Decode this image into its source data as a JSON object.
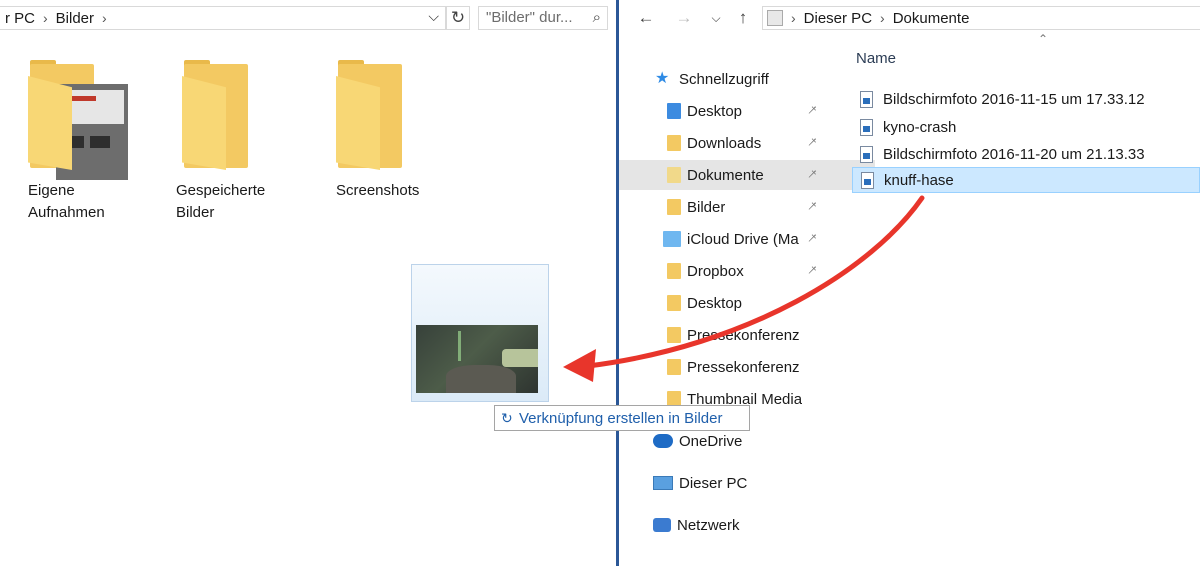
{
  "left": {
    "breadcrumb": [
      "r PC",
      "Bilder"
    ],
    "search_placeholder": "\"Bilder\" dur...",
    "items": [
      {
        "label": "Eigene\nAufnahmen"
      },
      {
        "label": "Gespeicherte\nBilder"
      },
      {
        "label": "Screenshots"
      }
    ]
  },
  "drag": {
    "tooltip": "Verknüpfung erstellen in Bilder"
  },
  "right": {
    "breadcrumb": [
      "Dieser PC",
      "Dokumente"
    ],
    "column_header": "Name",
    "nav": [
      {
        "label": "Schnellzugriff",
        "icon": "star-icon"
      },
      {
        "label": "Desktop",
        "icon": "folder-icon",
        "pinned": true
      },
      {
        "label": "Downloads",
        "icon": "download-folder-icon",
        "pinned": true
      },
      {
        "label": "Dokumente",
        "icon": "documents-folder-icon",
        "pinned": true,
        "selected": true
      },
      {
        "label": "Bilder",
        "icon": "pictures-folder-icon",
        "pinned": true
      },
      {
        "label": "iCloud Drive (Ma",
        "icon": "icloud-folder-icon",
        "pinned": true
      },
      {
        "label": "Dropbox",
        "icon": "dropbox-folder-icon",
        "pinned": true
      },
      {
        "label": "Desktop",
        "icon": "folder-icon"
      },
      {
        "label": "Pressekonferenz",
        "icon": "folder-icon"
      },
      {
        "label": "Pressekonferenz",
        "icon": "folder-icon"
      },
      {
        "label": "Thumbnail Media",
        "icon": "folder-icon"
      },
      {
        "label": "OneDrive",
        "icon": "onedrive-icon"
      },
      {
        "label": "Dieser PC",
        "icon": "computer-icon"
      },
      {
        "label": "Netzwerk",
        "icon": "network-icon"
      }
    ],
    "files": [
      {
        "name": "Bildschirmfoto 2016-11-15 um 17.33.12"
      },
      {
        "name": "kyno-crash"
      },
      {
        "name": "Bildschirmfoto 2016-11-20 um 21.13.33"
      },
      {
        "name": "knuff-hase",
        "selected": true
      }
    ]
  },
  "colors": {
    "accent": "#2b5797",
    "selection": "#cce8ff",
    "arrow": "#e8352b",
    "folder": "#f3c962"
  }
}
